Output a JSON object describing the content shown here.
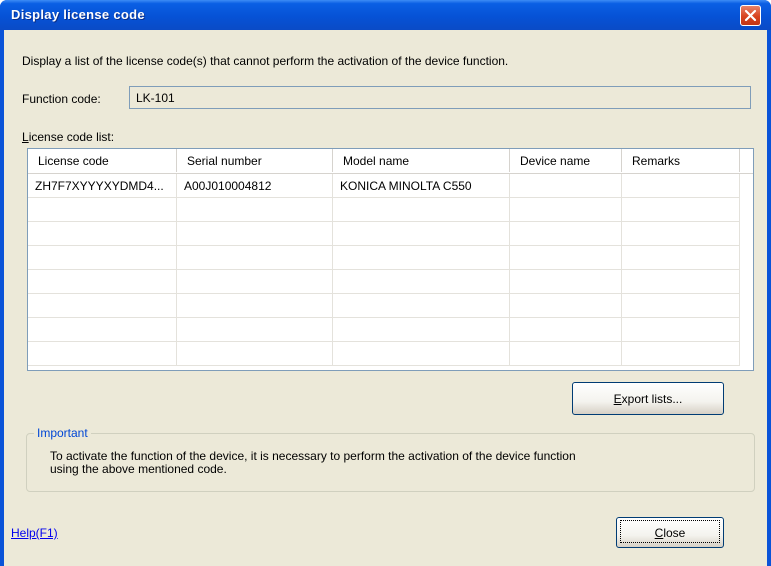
{
  "window": {
    "title": "Display license code"
  },
  "description": "Display a list of the license code(s) that cannot perform the activation of the device function.",
  "function_code": {
    "label": "Function code:",
    "value": "LK-101"
  },
  "license_list": {
    "label_first": "L",
    "label_rest": "icense code list:",
    "columns": [
      "License code",
      "Serial number",
      "Model name",
      "Device name",
      "Remarks"
    ],
    "rows": [
      [
        "ZH7F7XYYYXYDMD4...",
        "A00J010004812",
        "KONICA MINOLTA C550",
        "",
        ""
      ]
    ]
  },
  "export_button": {
    "first": "E",
    "rest": "xport lists..."
  },
  "important": {
    "legend": "Important",
    "line1": "To activate the function of the device, it is necessary to perform the activation of the device function",
    "line2": "using the above mentioned code."
  },
  "help_link": "Help(F1)",
  "close_button": {
    "first": "C",
    "rest": "lose"
  },
  "colors": {
    "title_bar": "#0a53d8",
    "dialog_bg": "#ece9d8",
    "close_icon": "#d8431e",
    "link": "#0000ee",
    "group_legend": "#0046d5"
  }
}
